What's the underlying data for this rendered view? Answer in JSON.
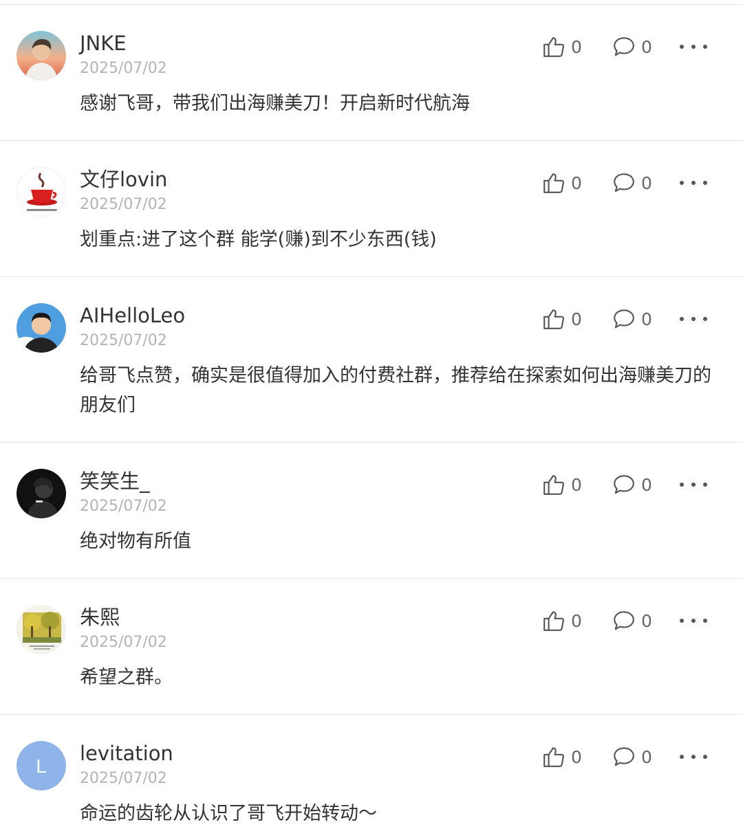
{
  "comments": [
    {
      "username": "JNKE",
      "date": "2025/07/02",
      "text": "感谢飞哥，带我们出海赚美刀！开启新时代航海",
      "likes": "0",
      "replies": "0",
      "avatar_icon": "cartoon-boy-avatar"
    },
    {
      "username": "文仔lovin",
      "date": "2025/07/02",
      "text": "划重点:进了这个群 能学(赚)到不少东西(钱)",
      "likes": "0",
      "replies": "0",
      "avatar_icon": "coffee-cup-avatar"
    },
    {
      "username": "AIHelloLeo",
      "date": "2025/07/02",
      "text": "给哥飞点赞，确实是很值得加入的付费社群，推荐给在探索如何出海赚美刀的朋友们",
      "likes": "0",
      "replies": "0",
      "avatar_icon": "cartoon-man-avatar"
    },
    {
      "username": "笑笑生_",
      "date": "2025/07/02",
      "text": "绝对物有所值",
      "likes": "0",
      "replies": "0",
      "avatar_icon": "dark-portrait-avatar"
    },
    {
      "username": "朱熙",
      "date": "2025/07/02",
      "text": "希望之群。",
      "likes": "0",
      "replies": "0",
      "avatar_icon": "autumn-trees-avatar"
    },
    {
      "username": "levitation",
      "date": "2025/07/02",
      "text": "命运的齿轮从认识了哥飞开始转动～",
      "likes": "0",
      "replies": "0",
      "avatar_icon": "letter-avatar",
      "avatar_letter": "L"
    }
  ],
  "icons": {
    "like": "thumbs-up-icon",
    "reply": "comment-bubble-icon",
    "more": "more-dots-icon"
  },
  "colors": {
    "text": "#333333",
    "muted": "#b3b3b3",
    "divider": "#e6e6e6",
    "letter_avatar_bg": "#8fb4ea"
  }
}
